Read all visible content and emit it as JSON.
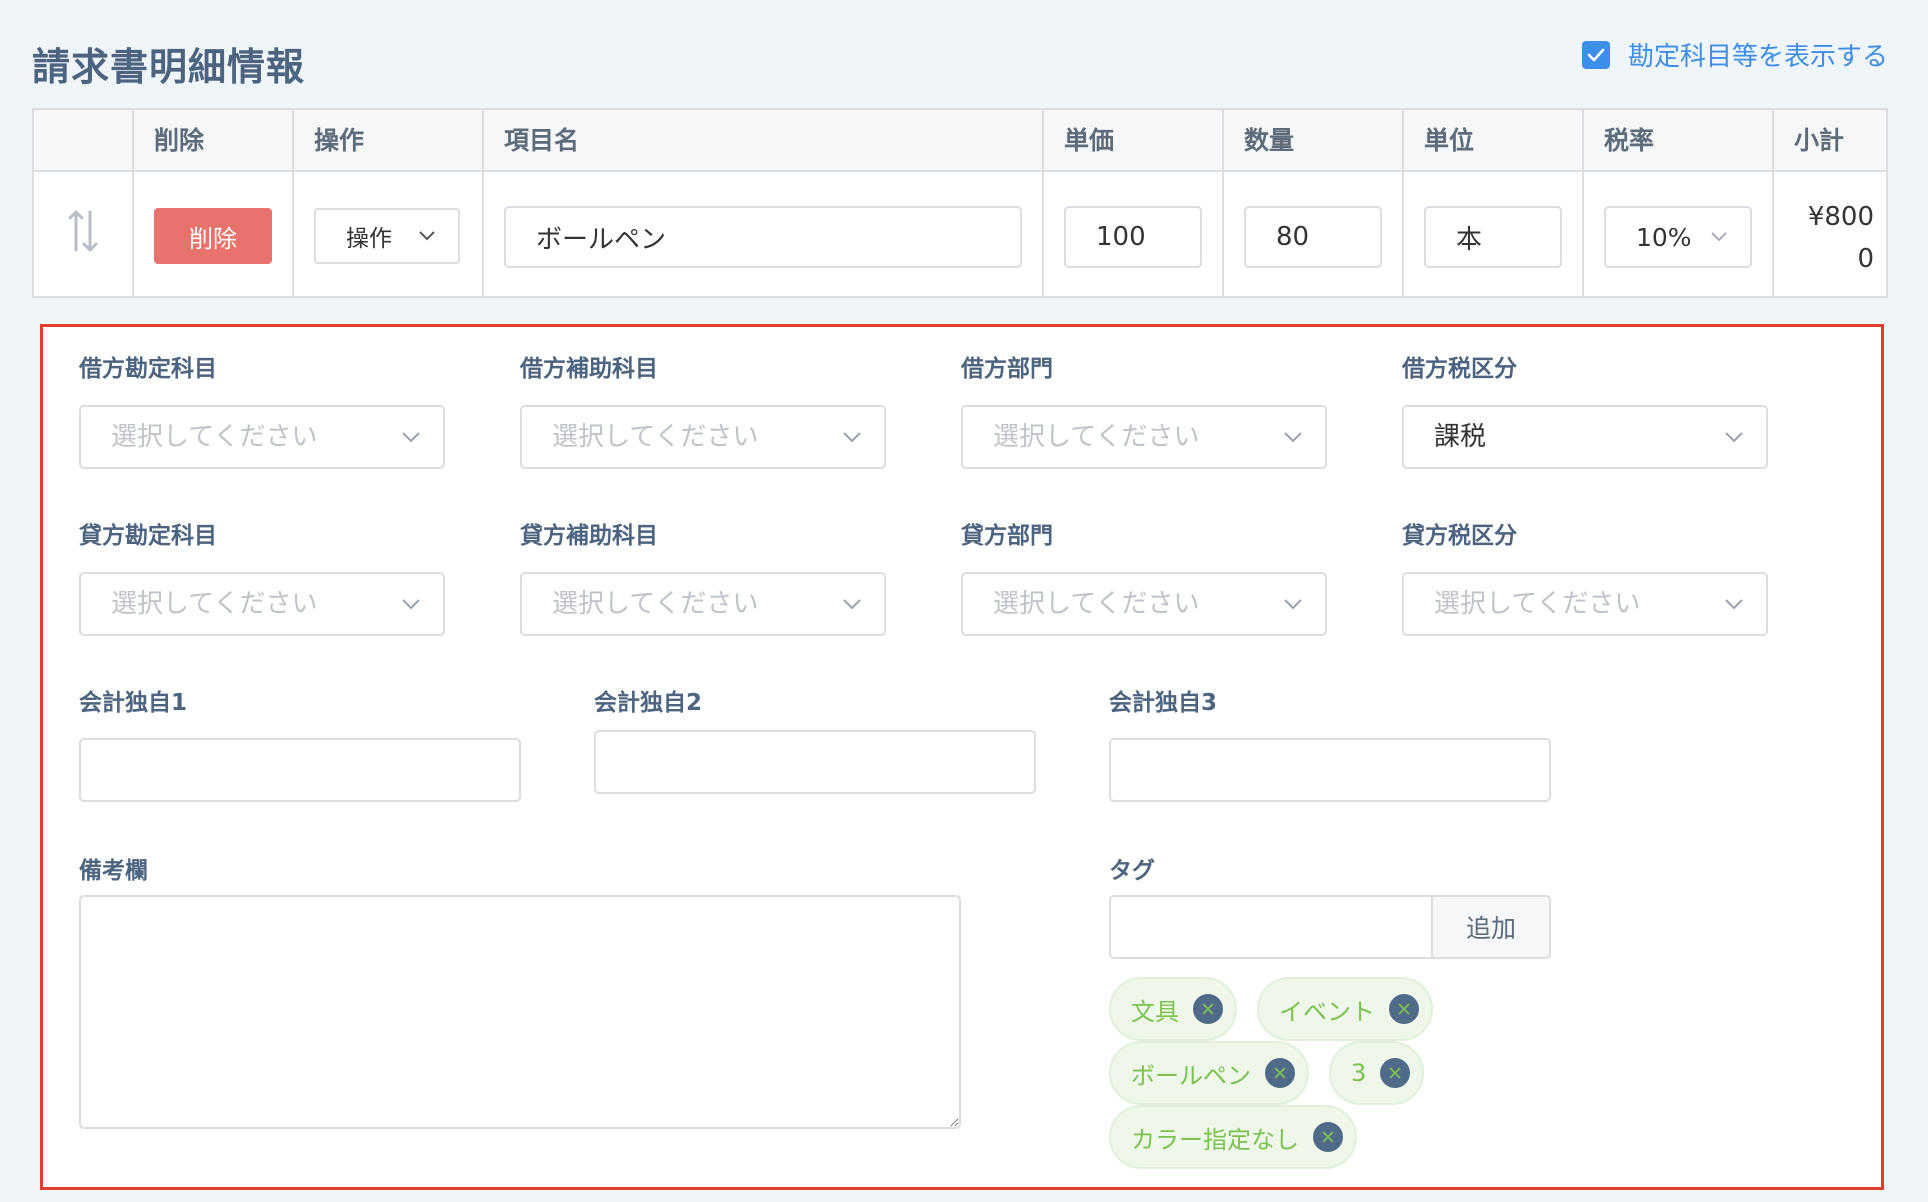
{
  "header": {
    "title": "請求書明細情報",
    "toggle_label": "勘定科目等を表示する",
    "toggle_checked": true
  },
  "table": {
    "columns": [
      "削除",
      "操作",
      "項目名",
      "単価",
      "数量",
      "単位",
      "税率",
      "小計"
    ],
    "row": {
      "delete_label": "削除",
      "operation_label": "操作",
      "item_name": "ボールペン",
      "unit_price": "100",
      "quantity": "80",
      "unit": "本",
      "tax_rate": "10%",
      "subtotal": "¥8000"
    }
  },
  "accounting": {
    "placeholder": "選択してください",
    "debit": {
      "account_label": "借方勘定科目",
      "sub_account_label": "借方補助科目",
      "department_label": "借方部門",
      "tax_label": "借方税区分",
      "tax_value": "課税"
    },
    "credit": {
      "account_label": "貸方勘定科目",
      "sub_account_label": "貸方補助科目",
      "department_label": "貸方部門",
      "tax_label": "貸方税区分"
    },
    "custom": [
      "会計独自1",
      "会計独自2",
      "会計独自3"
    ],
    "remarks_label": "備考欄",
    "tags_label": "タグ",
    "tag_add_label": "追加",
    "tags": [
      "文具",
      "イベント",
      "ボールペン",
      "3",
      "カラー指定なし"
    ]
  },
  "colors": {
    "accent": "#3d8ee8",
    "danger": "#e8736c",
    "panel_border": "#e03e2f",
    "tag_text": "#7cc24f"
  }
}
